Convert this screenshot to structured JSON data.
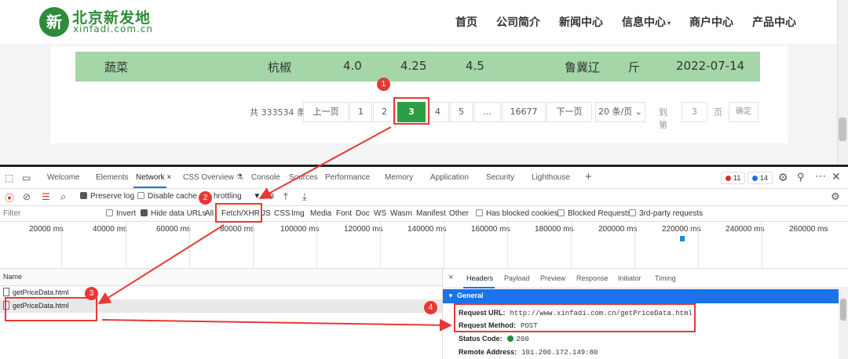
{
  "site": {
    "logo_mark": "新",
    "logo_cn": "北京新发地",
    "logo_en": "xinfadi.com.cn",
    "nav": [
      "首页",
      "公司简介",
      "新闻中心",
      "信息中心",
      "商户中心",
      "产品中心"
    ],
    "row": {
      "category": "蔬菜",
      "name": "杭椒",
      "low": "4.0",
      "avg": "4.25",
      "high": "4.5",
      "origin": "鲁冀辽",
      "unit": "斤",
      "date": "2022-07-14"
    },
    "pager": {
      "total": "共 333534 条",
      "prev": "上一页",
      "pages": [
        "1",
        "2",
        "3",
        "4",
        "5",
        "…",
        "16677"
      ],
      "current": "3",
      "next": "下一页",
      "page_size": "20 条/页",
      "goto_label": "到第",
      "goto_value": "3",
      "goto_unit": "页",
      "confirm": "确定"
    }
  },
  "devtools": {
    "tabs": [
      "Welcome",
      "Elements",
      "Network",
      "CSS Overview",
      "Console",
      "Sources",
      "Performance",
      "Memory",
      "Application",
      "Security",
      "Lighthouse"
    ],
    "active_tab": "Network",
    "errors": "11",
    "messages": "14",
    "toolbar": {
      "preserve_log": "Preserve log",
      "disable_cache": "Disable cache",
      "throttling": "hrottling"
    },
    "filter": {
      "placeholder": "Filter",
      "invert": "Invert",
      "hide_data_urls": "Hide data URLs",
      "types": [
        "All",
        "Fetch/XHR",
        "JS",
        "CSS",
        "Img",
        "Media",
        "Font",
        "Doc",
        "WS",
        "Wasm",
        "Manifest",
        "Other"
      ],
      "has_blocked_cookies": "Has blocked cookies",
      "blocked_requests": "Blocked Requests",
      "third_party": "3rd-party requests"
    },
    "timeline_labels": [
      "20000 ms",
      "40000 ms",
      "60000 ms",
      "80000 ms",
      "100000 ms",
      "120000 ms",
      "140000 ms",
      "160000 ms",
      "180000 ms",
      "200000 ms",
      "220000 ms",
      "240000 ms",
      "260000 ms"
    ],
    "requests_header": "Name",
    "requests": [
      "getPriceData.html",
      "getPriceData.html"
    ],
    "detail_tabs": [
      "Headers",
      "Payload",
      "Preview",
      "Response",
      "Initiator",
      "Timing"
    ],
    "general_title": "General",
    "headers": {
      "url_label": "Request URL:",
      "url_value": "http://www.xinfadi.com.cn/getPriceData.html",
      "method_label": "Request Method:",
      "method_value": "POST",
      "status_label": "Status Code:",
      "status_value": "200",
      "remote_label": "Remote Address:",
      "remote_value": "101.200.172.149:80"
    }
  },
  "annotations": [
    "1",
    "2",
    "3",
    "4"
  ],
  "colors": {
    "brand_green": "#2f8a3b",
    "row_green": "#a5d6a7",
    "current_page": "#2e9e44",
    "devtools_blue": "#1a73e8",
    "annotation_red": "#e53935"
  }
}
